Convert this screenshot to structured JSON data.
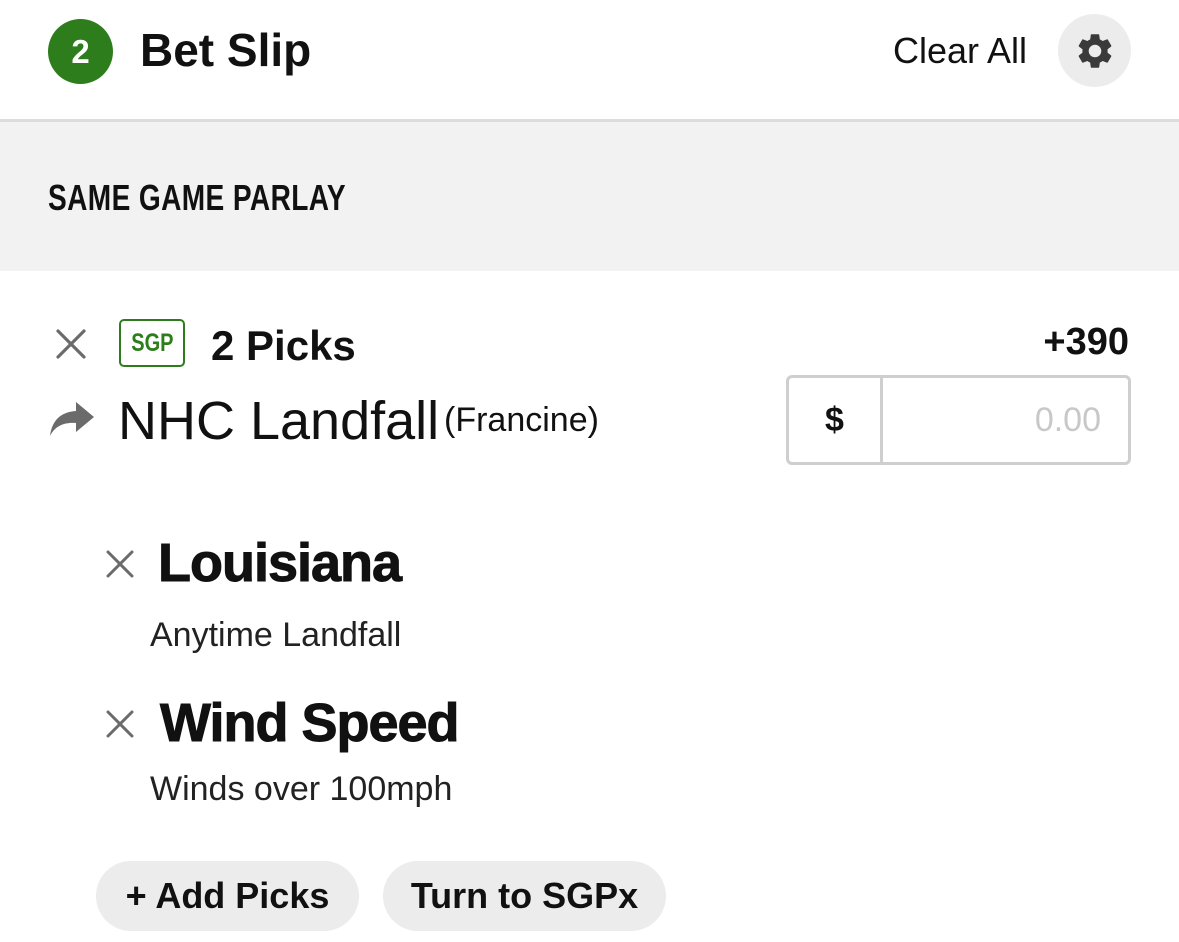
{
  "header": {
    "count_badge": "2",
    "title": "Bet Slip",
    "clear_all_label": "Clear All",
    "settings_icon": "gear-icon"
  },
  "section": {
    "title": "SAME GAME PARLAY"
  },
  "parlay": {
    "tag": "SGP",
    "picks_label": "2 Picks",
    "odds": "+390",
    "event_icon": "share-arrow-icon",
    "event_name": "NHC Landfall",
    "event_sub": "(Francine)",
    "wager": {
      "currency": "$",
      "placeholder": "0.00"
    },
    "legs": [
      {
        "title": "Louisiana",
        "subtitle": "Anytime Landfall"
      },
      {
        "title": "Wind Speed",
        "subtitle": "Winds over 100mph"
      }
    ]
  },
  "actions": {
    "add_picks_label": "+ Add Picks",
    "turn_sgpx_label": "Turn to SGPx"
  },
  "colors": {
    "brand_green": "#2e7d1c",
    "section_bg": "#f2f2f2",
    "pill_bg": "#ececec"
  }
}
